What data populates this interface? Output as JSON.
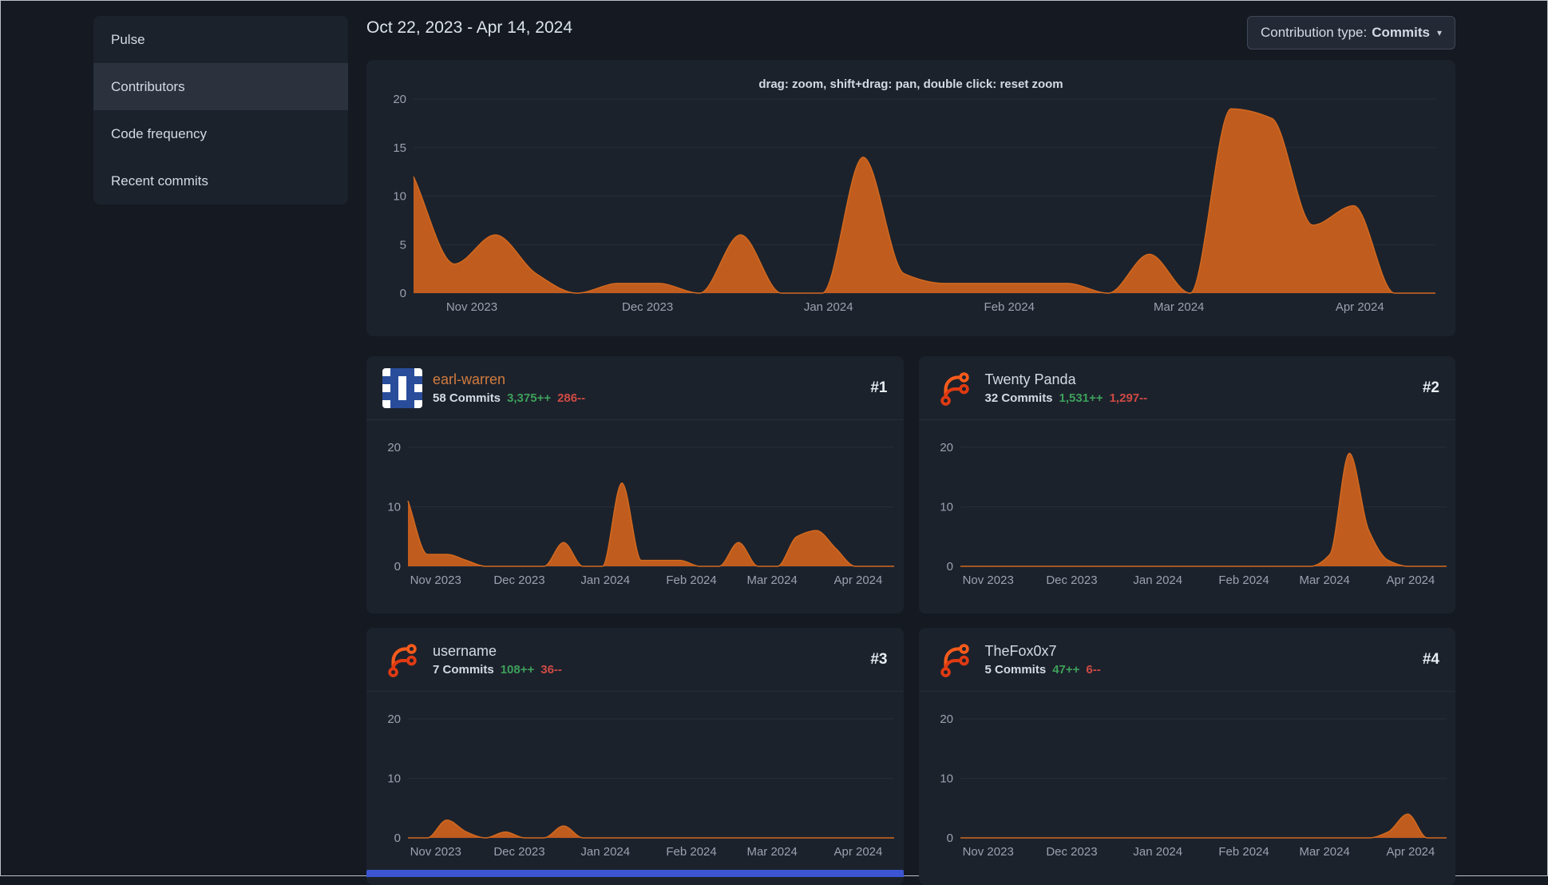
{
  "sidebar": {
    "items": [
      {
        "label": "Pulse",
        "active": false
      },
      {
        "label": "Contributors",
        "active": true
      },
      {
        "label": "Code frequency",
        "active": false
      },
      {
        "label": "Recent commits",
        "active": false
      }
    ]
  },
  "header": {
    "date_range": "Oct 22, 2023 - Apr 14, 2024",
    "contribution_type_label": "Contribution type:",
    "contribution_type_value": "Commits"
  },
  "main_chart": {
    "hint": "drag: zoom, shift+drag: pan, double click: reset zoom"
  },
  "contributors": [
    {
      "name": "earl-warren",
      "name_color": "#d27c3f",
      "rank": "#1",
      "commits": "58 Commits",
      "additions": "3,375++",
      "deletions": "286--",
      "avatar": "identicon"
    },
    {
      "name": "Twenty Panda",
      "name_color": "#d3dae4",
      "rank": "#2",
      "commits": "32 Commits",
      "additions": "1,531++",
      "deletions": "1,297--",
      "avatar": "forgejo-logo"
    },
    {
      "name": "username",
      "name_color": "#d3dae4",
      "rank": "#3",
      "commits": "7 Commits",
      "additions": "108++",
      "deletions": "36--",
      "avatar": "forgejo-logo"
    },
    {
      "name": "TheFox0x7",
      "name_color": "#d3dae4",
      "rank": "#4",
      "commits": "5 Commits",
      "additions": "47++",
      "deletions": "6--",
      "avatar": "forgejo-logo"
    }
  ],
  "chart_data": [
    {
      "type": "area",
      "series": "all contributors",
      "interval": "week",
      "x_range": "Oct 22, 2023 - Apr 14, 2024",
      "ylim": [
        0,
        20
      ],
      "yticks": [
        0,
        5,
        10,
        15,
        20
      ],
      "xticks": [
        {
          "f": 0.057,
          "label": "Nov 2023"
        },
        {
          "f": 0.229,
          "label": "Dec 2023"
        },
        {
          "f": 0.406,
          "label": "Jan 2024"
        },
        {
          "f": 0.583,
          "label": "Feb 2024"
        },
        {
          "f": 0.749,
          "label": "Mar 2024"
        },
        {
          "f": 0.926,
          "label": "Apr 2024"
        }
      ],
      "values": [
        12,
        3,
        6,
        2,
        0,
        1,
        1,
        0,
        6,
        0,
        0,
        14,
        2,
        1,
        1,
        1,
        1,
        0,
        4,
        0,
        19,
        18,
        7,
        9,
        0,
        0
      ]
    },
    {
      "type": "area",
      "series": "earl-warren",
      "interval": "week",
      "x_range": "Oct 22, 2023 - Apr 14, 2024",
      "ylim": [
        0,
        20
      ],
      "yticks": [
        0,
        10,
        20
      ],
      "xticks": [
        {
          "f": 0.057,
          "label": "Nov 2023"
        },
        {
          "f": 0.229,
          "label": "Dec 2023"
        },
        {
          "f": 0.406,
          "label": "Jan 2024"
        },
        {
          "f": 0.583,
          "label": "Feb 2024"
        },
        {
          "f": 0.749,
          "label": "Mar 2024"
        },
        {
          "f": 0.926,
          "label": "Apr 2024"
        }
      ],
      "values": [
        11,
        2,
        2,
        1,
        0,
        0,
        0,
        0,
        4,
        0,
        0,
        14,
        1,
        1,
        1,
        0,
        0,
        4,
        0,
        0,
        5,
        6,
        3,
        0,
        0,
        0
      ]
    },
    {
      "type": "area",
      "series": "Twenty Panda",
      "interval": "week",
      "x_range": "Oct 22, 2023 - Apr 14, 2024",
      "ylim": [
        0,
        20
      ],
      "yticks": [
        0,
        10,
        20
      ],
      "xticks": [
        {
          "f": 0.057,
          "label": "Nov 2023"
        },
        {
          "f": 0.229,
          "label": "Dec 2023"
        },
        {
          "f": 0.406,
          "label": "Jan 2024"
        },
        {
          "f": 0.583,
          "label": "Feb 2024"
        },
        {
          "f": 0.749,
          "label": "Mar 2024"
        },
        {
          "f": 0.926,
          "label": "Apr 2024"
        }
      ],
      "values": [
        0,
        0,
        0,
        0,
        0,
        0,
        0,
        0,
        0,
        0,
        0,
        0,
        0,
        0,
        0,
        0,
        0,
        0,
        0,
        2,
        19,
        6,
        1,
        0,
        0,
        0
      ]
    },
    {
      "type": "area",
      "series": "username",
      "interval": "week",
      "x_range": "Oct 22, 2023 - Apr 14, 2024",
      "ylim": [
        0,
        20
      ],
      "yticks": [
        0,
        10,
        20
      ],
      "xticks": [
        {
          "f": 0.057,
          "label": "Nov 2023"
        },
        {
          "f": 0.229,
          "label": "Dec 2023"
        },
        {
          "f": 0.406,
          "label": "Jan 2024"
        },
        {
          "f": 0.583,
          "label": "Feb 2024"
        },
        {
          "f": 0.749,
          "label": "Mar 2024"
        },
        {
          "f": 0.926,
          "label": "Apr 2024"
        }
      ],
      "values": [
        0,
        0,
        3,
        1,
        0,
        1,
        0,
        0,
        2,
        0,
        0,
        0,
        0,
        0,
        0,
        0,
        0,
        0,
        0,
        0,
        0,
        0,
        0,
        0,
        0,
        0
      ]
    },
    {
      "type": "area",
      "series": "TheFox0x7",
      "interval": "week",
      "x_range": "Oct 22, 2023 - Apr 14, 2024",
      "ylim": [
        0,
        20
      ],
      "yticks": [
        0,
        10,
        20
      ],
      "xticks": [
        {
          "f": 0.057,
          "label": "Nov 2023"
        },
        {
          "f": 0.229,
          "label": "Dec 2023"
        },
        {
          "f": 0.406,
          "label": "Jan 2024"
        },
        {
          "f": 0.583,
          "label": "Feb 2024"
        },
        {
          "f": 0.749,
          "label": "Mar 2024"
        },
        {
          "f": 0.926,
          "label": "Apr 2024"
        }
      ],
      "values": [
        0,
        0,
        0,
        0,
        0,
        0,
        0,
        0,
        0,
        0,
        0,
        0,
        0,
        0,
        0,
        0,
        0,
        0,
        0,
        0,
        0,
        0,
        1,
        4,
        0,
        0
      ]
    }
  ],
  "colors": {
    "chart_fill": "#c05c1e",
    "chart_line": "#d2691e",
    "grid": "#262d38",
    "axis_text": "#9aa2b0",
    "additions_green": "#3da05a",
    "deletions_red": "#cf4a44",
    "accent_link": "#d27c3f"
  }
}
